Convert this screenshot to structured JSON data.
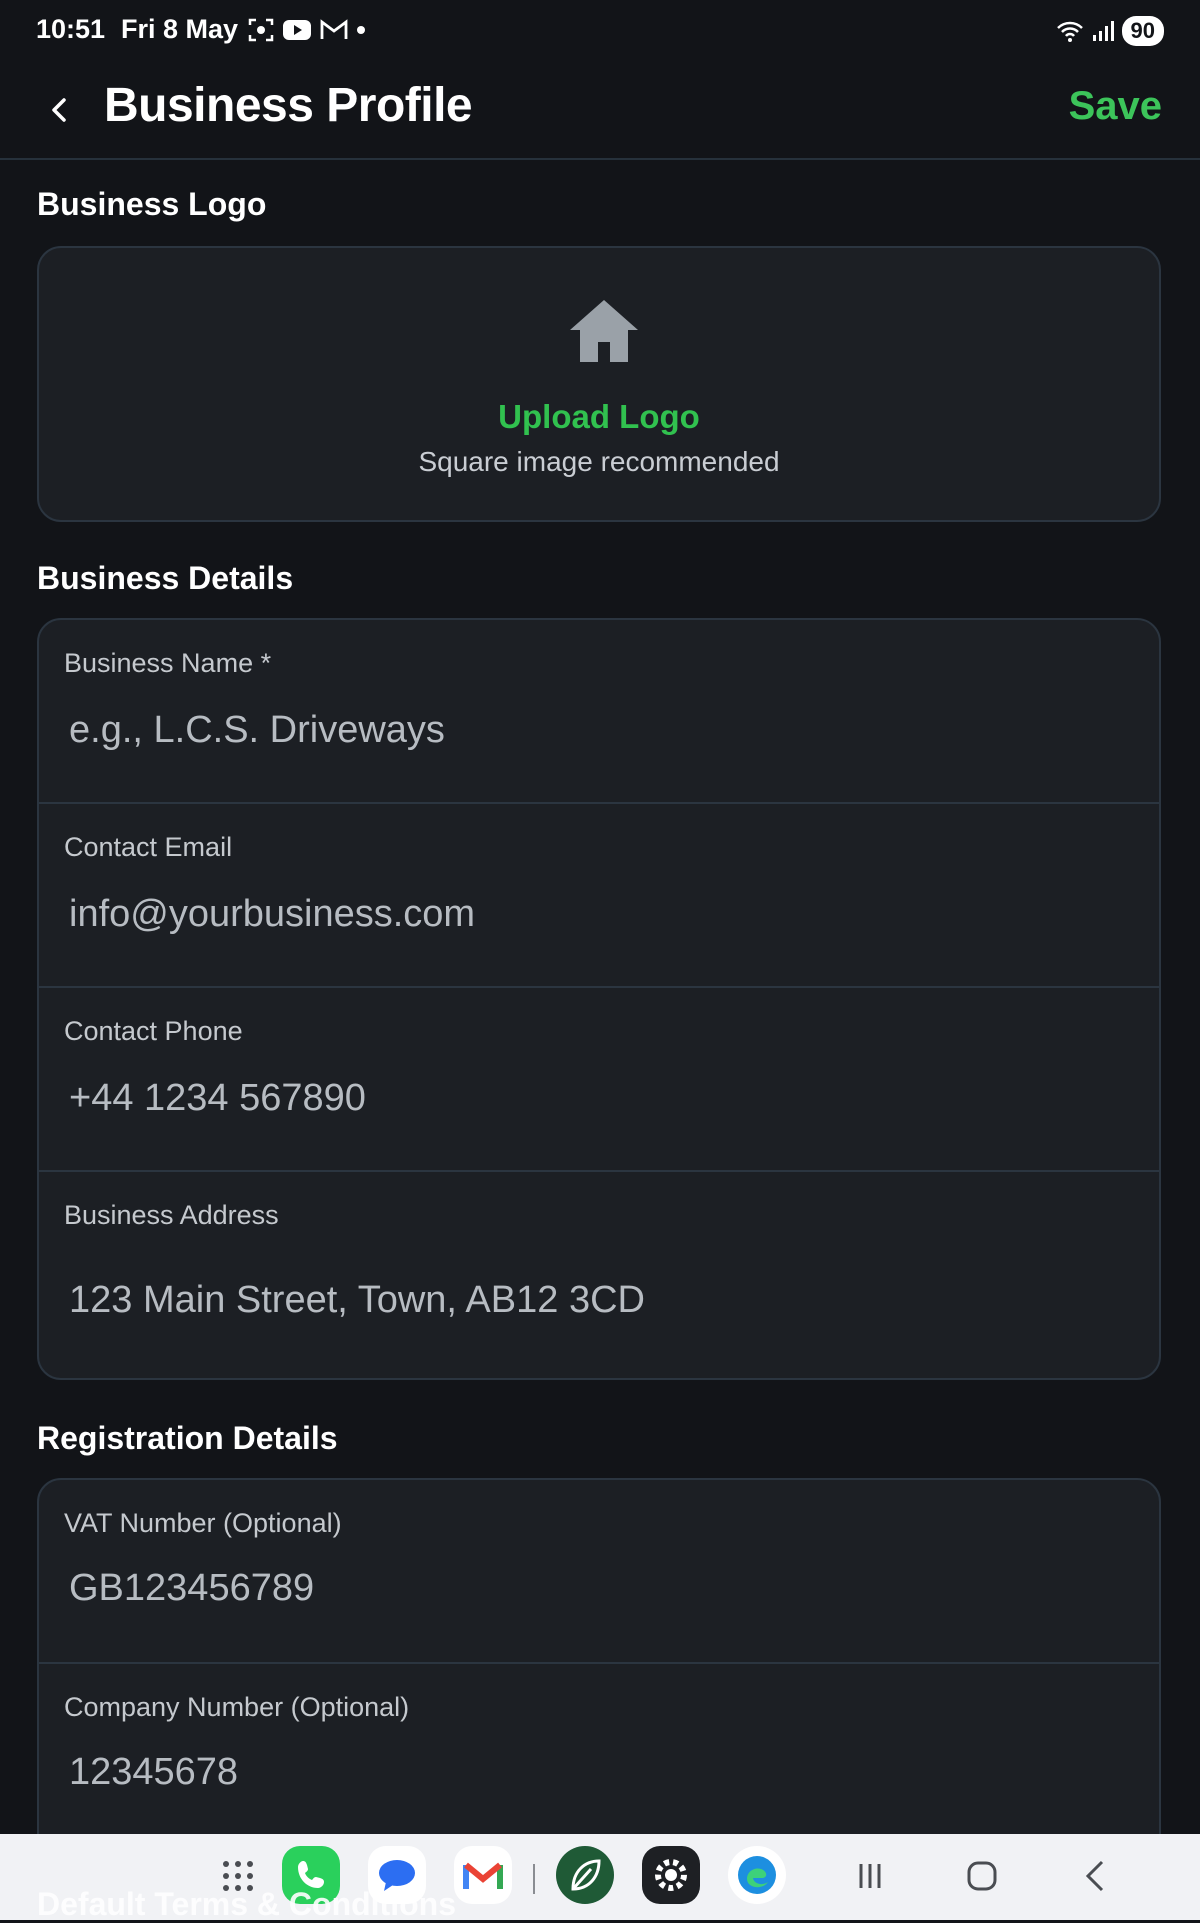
{
  "status_bar": {
    "time": "10:51",
    "date": "Fri 8 May",
    "battery": "90",
    "icons": [
      "screenshot-icon",
      "youtube-icon",
      "gmail-icon",
      "dot-icon",
      "wifi-icon",
      "signal-icon"
    ]
  },
  "header": {
    "title": "Business Profile",
    "save_label": "Save"
  },
  "logo_section": {
    "heading": "Business Logo",
    "upload_label": "Upload Logo",
    "hint": "Square image recommended"
  },
  "details_section": {
    "heading": "Business Details",
    "fields": [
      {
        "label": "Business Name *",
        "placeholder": "e.g., L.C.S. Driveways"
      },
      {
        "label": "Contact Email",
        "placeholder": "info@yourbusiness.com"
      },
      {
        "label": "Contact Phone",
        "placeholder": "+44 1234 567890"
      },
      {
        "label": "Business Address",
        "placeholder": "123 Main Street, Town, AB12 3CD"
      }
    ]
  },
  "registration_section": {
    "heading": "Registration Details",
    "fields": [
      {
        "label": "VAT Number (Optional)",
        "placeholder": "GB123456789"
      },
      {
        "label": "Company Number (Optional)",
        "placeholder": "12345678"
      }
    ]
  },
  "next_section": {
    "heading": "Default Terms & Conditions"
  },
  "nav_bar": {
    "apps": [
      "app-drawer-icon",
      "phone-app-icon",
      "messages-app-icon",
      "gmail-app-icon",
      "leaf-app-icon",
      "settings-app-icon",
      "edge-app-icon"
    ],
    "buttons": [
      "recents-icon",
      "home-icon",
      "back-icon"
    ]
  },
  "colors": {
    "background": "#121418",
    "card": "#1c1f24",
    "border": "#2b3540",
    "accent": "#3cc45a"
  }
}
